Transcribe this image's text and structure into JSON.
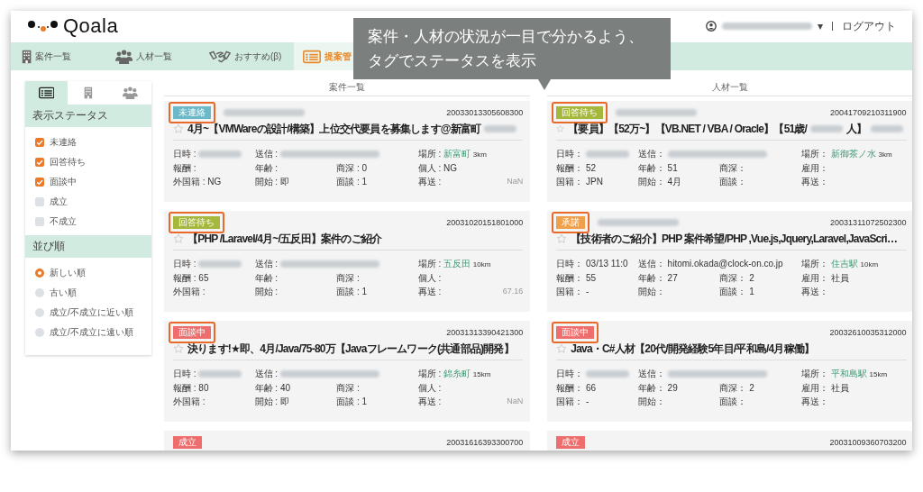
{
  "header": {
    "logo": "Qoala",
    "caret": "▾",
    "logout": "ログアウト"
  },
  "nav_tabs": [
    {
      "label": "案件一覧",
      "selected": false
    },
    {
      "label": "人材一覧",
      "selected": false
    },
    {
      "label": "おすすめ(β)",
      "selected": false
    },
    {
      "label": "提案管",
      "selected": true
    }
  ],
  "callout": {
    "lines": [
      "案件・人材の状況が一目で分かるよう、",
      "タグでステータスを表示"
    ]
  },
  "sidebar": {
    "view_tabs": [
      {
        "selected": true
      },
      {
        "selected": false
      },
      {
        "selected": false
      }
    ],
    "status_title": "表示ステータス",
    "statuses": [
      {
        "label": "未連絡",
        "checked": true
      },
      {
        "label": "回答待ち",
        "checked": true
      },
      {
        "label": "面談中",
        "checked": true
      },
      {
        "label": "成立",
        "checked": false
      },
      {
        "label": "不成立",
        "checked": false
      }
    ],
    "sort_title": "並び順",
    "sorts": [
      {
        "label": "新しい順",
        "selected": true
      },
      {
        "label": "古い順",
        "selected": false
      },
      {
        "label": "成立/不成立に近い順",
        "selected": false
      },
      {
        "label": "成立/不成立に遠い順",
        "selected": false
      }
    ]
  },
  "columns": [
    {
      "title": "案件一覧",
      "cards": [
        {
          "tag": "未連絡",
          "color": "#6bb8c9",
          "highlighted": true,
          "sender_blurred": true,
          "id": "20033013305608300",
          "title": [
            {
              "kind": "text",
              "text": "4月~【VMWareの設計/構築】上位交代要員を募集します@新富町"
            },
            {
              "kind": "blur"
            }
          ],
          "rows": [
            [
              {
                "label": "日時 :",
                "kind": "blur"
              },
              {
                "label": "送信 :",
                "kind": "blur-long"
              },
              "",
              {
                "label": "場所 :",
                "kind": "place",
                "value": "新富町",
                "distance": "3km"
              }
            ],
            [
              {
                "label": "報酬 :",
                "kind": "text"
              },
              {
                "label": "年齢 :",
                "kind": "text"
              },
              {
                "label": "商深 :",
                "kind": "text",
                "value": "0"
              },
              {
                "label": "個人 :",
                "kind": "text",
                "value": "NG"
              }
            ],
            [
              {
                "label": "外国籍 :",
                "kind": "text",
                "value": "NG"
              },
              {
                "label": "開始 :",
                "kind": "text",
                "value": "即"
              },
              {
                "label": "面談 :",
                "kind": "text",
                "value": "1"
              },
              {
                "label": "再送 :",
                "kind": "text"
              }
            ]
          ],
          "note": "NaN"
        },
        {
          "tag": "回答待ち",
          "color": "#a6b83c",
          "highlighted": true,
          "sender_blurred": false,
          "id": "20031020151801000",
          "title": [
            {
              "kind": "text",
              "text": "【PHP /Laravel/4月~/五反田】案件のご紹介"
            }
          ],
          "rows": [
            [
              {
                "label": "日時 :",
                "kind": "blur"
              },
              {
                "label": "送信 :",
                "kind": "blur-long"
              },
              "",
              {
                "label": "場所 :",
                "kind": "place",
                "value": "五反田",
                "distance": "10km"
              }
            ],
            [
              {
                "label": "報酬 :",
                "kind": "text",
                "value": "65"
              },
              {
                "label": "年齢 :",
                "kind": "text"
              },
              {
                "label": "商深 :",
                "kind": "text"
              },
              {
                "label": "個人 :",
                "kind": "text"
              }
            ],
            [
              {
                "label": "外国籍 :",
                "kind": "text"
              },
              {
                "label": "開始 :",
                "kind": "text"
              },
              {
                "label": "面談 :",
                "kind": "text",
                "value": "1"
              },
              {
                "label": "再送 :",
                "kind": "text"
              }
            ]
          ],
          "note": "67.16"
        },
        {
          "tag": "面談中",
          "color": "#ee6d6d",
          "highlighted": true,
          "sender_blurred": false,
          "id": "20031313390421300",
          "title": [
            {
              "kind": "text",
              "text": "決ります!★即、4月/Java/75-80万【Javaフレームワーク(共通部品)開発】"
            }
          ],
          "rows": [
            [
              {
                "label": "日時 :",
                "kind": "blur"
              },
              {
                "label": "送信 :",
                "kind": "blur-long"
              },
              "",
              {
                "label": "場所 :",
                "kind": "place",
                "value": "錦糸町",
                "distance": "15km"
              }
            ],
            [
              {
                "label": "報酬 :",
                "kind": "text",
                "value": "80"
              },
              {
                "label": "年齢 :",
                "kind": "text",
                "value": "40"
              },
              {
                "label": "商深 :",
                "kind": "text"
              },
              {
                "label": "個人 :",
                "kind": "text"
              }
            ],
            [
              {
                "label": "外国籍 :",
                "kind": "text"
              },
              {
                "label": "開始 :",
                "kind": "text",
                "value": "即"
              },
              {
                "label": "面談 :",
                "kind": "text",
                "value": "1"
              },
              {
                "label": "再送 :",
                "kind": "text"
              }
            ]
          ],
          "note": "NaN"
        },
        {
          "tag": "成立",
          "color": "#ee6d6d",
          "highlighted": false,
          "sender_blurred": false,
          "id": "20031616393300700"
        }
      ]
    },
    {
      "title": "人材一覧",
      "cards": [
        {
          "tag": "回答待ち",
          "color": "#a6b83c",
          "highlighted": true,
          "sender_blurred": true,
          "id": "20041709210311900",
          "title": [
            {
              "kind": "text",
              "text": "【要員】【52万~】【VB.NET / VBA / Oracle】【51歳/"
            },
            {
              "kind": "blur"
            },
            {
              "kind": "text",
              "text": "人】"
            },
            {
              "kind": "blur"
            }
          ],
          "rows": [
            [
              {
                "label": "日時：",
                "kind": "blur"
              },
              {
                "label": "送信：",
                "kind": "blur-long"
              },
              "",
              {
                "label": "場所：",
                "kind": "place",
                "value": "新御茶ノ水",
                "distance": "3km"
              }
            ],
            [
              {
                "label": "報酬：",
                "kind": "text",
                "value": "52"
              },
              {
                "label": "年齢：",
                "kind": "text",
                "value": "51"
              },
              {
                "label": "商深：",
                "kind": "text"
              },
              {
                "label": "雇用：",
                "kind": "text"
              }
            ],
            [
              {
                "label": "国籍：",
                "kind": "text",
                "value": "JPN"
              },
              {
                "label": "開始：",
                "kind": "text",
                "value": "4月"
              },
              {
                "label": "面談：",
                "kind": "text"
              },
              {
                "label": "再送：",
                "kind": "text"
              }
            ]
          ]
        },
        {
          "tag": "承諾",
          "color": "#f0a04b",
          "highlighted": true,
          "sender_blurred": true,
          "id": "20031311072502300",
          "title": [
            {
              "kind": "text",
              "text": "【技術者のご紹介】PHP 案件希望/PHP ,Vue.js,Jquery,Laravel,JavaScri…"
            }
          ],
          "rows": [
            [
              {
                "label": "日時：",
                "kind": "text",
                "value": "03/13 11:0"
              },
              {
                "label": "送信：",
                "kind": "text",
                "value": "hitomi.okada@clock-on.co.jp"
              },
              "",
              {
                "label": "場所：",
                "kind": "place",
                "value": "住吉駅",
                "distance": "10km"
              }
            ],
            [
              {
                "label": "報酬：",
                "kind": "text",
                "value": "55"
              },
              {
                "label": "年齢：",
                "kind": "text",
                "value": "27"
              },
              {
                "label": "商深：",
                "kind": "text",
                "value": "2"
              },
              {
                "label": "雇用：",
                "kind": "text",
                "value": "社員"
              }
            ],
            [
              {
                "label": "国籍：",
                "kind": "text",
                "value": "-"
              },
              {
                "label": "開始：",
                "kind": "text"
              },
              {
                "label": "面談：",
                "kind": "text",
                "value": "1"
              },
              {
                "label": "再送：",
                "kind": "text"
              }
            ]
          ]
        },
        {
          "tag": "面談中",
          "color": "#ee6d6d",
          "highlighted": true,
          "sender_blurred": false,
          "id": "20032610035312000",
          "title": [
            {
              "kind": "text",
              "text": "Java・C#人材【20代/開発経験5年目/平和島/4月稼働】"
            }
          ],
          "rows": [
            [
              {
                "label": "日時：",
                "kind": "blur"
              },
              {
                "label": "送信：",
                "kind": "blur-long"
              },
              "",
              {
                "label": "場所：",
                "kind": "place",
                "value": "平和島駅",
                "distance": "15km"
              }
            ],
            [
              {
                "label": "報酬：",
                "kind": "text",
                "value": "66"
              },
              {
                "label": "年齢：",
                "kind": "text",
                "value": "29"
              },
              {
                "label": "商深：",
                "kind": "text",
                "value": "2"
              },
              {
                "label": "雇用：",
                "kind": "text",
                "value": "社員"
              }
            ],
            [
              {
                "label": "国籍：",
                "kind": "text",
                "value": "-"
              },
              {
                "label": "開始：",
                "kind": "text"
              },
              {
                "label": "面談：",
                "kind": "text"
              },
              {
                "label": "再送：",
                "kind": "text"
              }
            ]
          ]
        },
        {
          "tag": "成立",
          "color": "#ee6d6d",
          "highlighted": false,
          "sender_blurred": false,
          "id": "20031009360703200"
        }
      ]
    }
  ]
}
